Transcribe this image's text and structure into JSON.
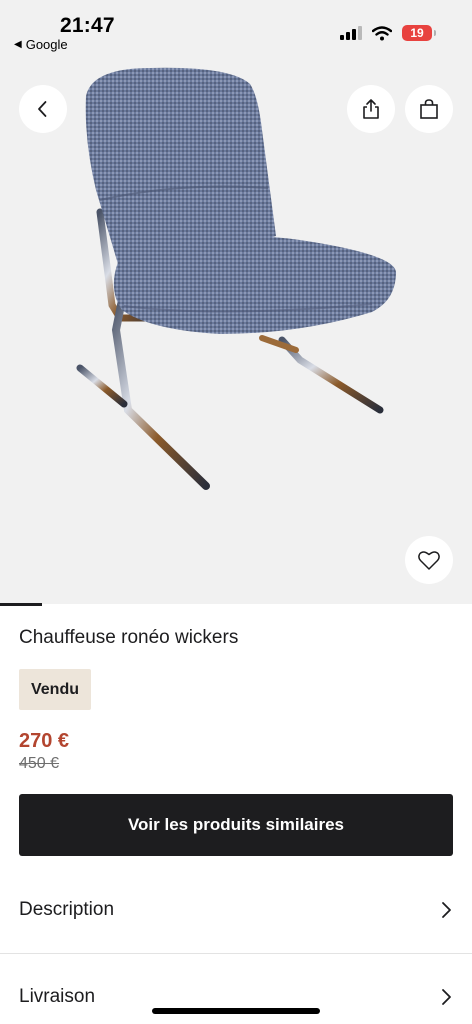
{
  "status_bar": {
    "time": "21:47",
    "back_app": "Google",
    "battery": "19",
    "battery_color": "#e8423f"
  },
  "product": {
    "title": "Chauffeuse ronéo wickers",
    "badge": "Vendu",
    "price": "270 €",
    "old_price": "450 €",
    "price_color": "#b3452f",
    "image_index": 1,
    "image_count": 11
  },
  "actions": {
    "cta_label": "Voir les produits similaires",
    "back_icon": "chevron-left-icon",
    "share_icon": "share-icon",
    "bag_icon": "shopping-bag-icon",
    "favorite_icon": "heart-icon"
  },
  "sections": [
    {
      "label": "Description"
    },
    {
      "label": "Livraison"
    }
  ],
  "colors": {
    "primary": "#1d1d1f",
    "badge_bg": "#ede5da",
    "hero_bg": "#f1f1f1"
  }
}
